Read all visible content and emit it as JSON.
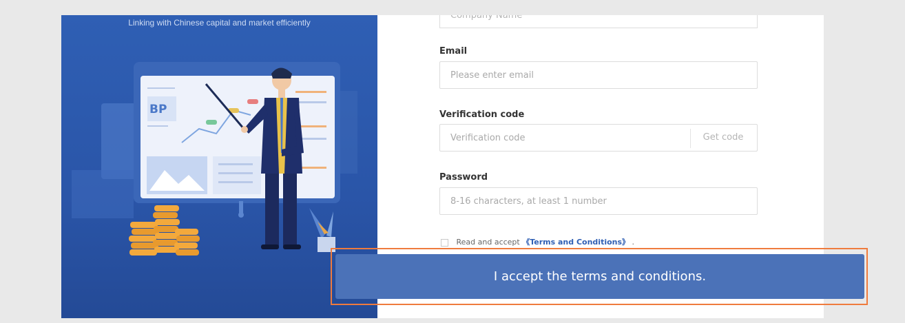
{
  "left_panel": {
    "tagline": "Linking with Chinese capital and market efficiently",
    "board_text": "BP"
  },
  "form": {
    "company": {
      "placeholder": "Company Name"
    },
    "email": {
      "label": "Email",
      "placeholder": "Please enter email"
    },
    "verification": {
      "label": "Verification code",
      "placeholder": "Verification code",
      "get_code": "Get code"
    },
    "password": {
      "label": "Password",
      "placeholder": "8-16 characters, at least 1 number"
    },
    "terms": {
      "prefix": "Read and accept",
      "link": "《Terms and Conditions》",
      "suffix": "."
    }
  },
  "overlay": {
    "accept_button": "I accept the terms and conditions."
  },
  "colors": {
    "panel_blue": "#2f5fb4",
    "button_blue": "#4b72b8",
    "highlight_orange": "#ef7b3d"
  }
}
